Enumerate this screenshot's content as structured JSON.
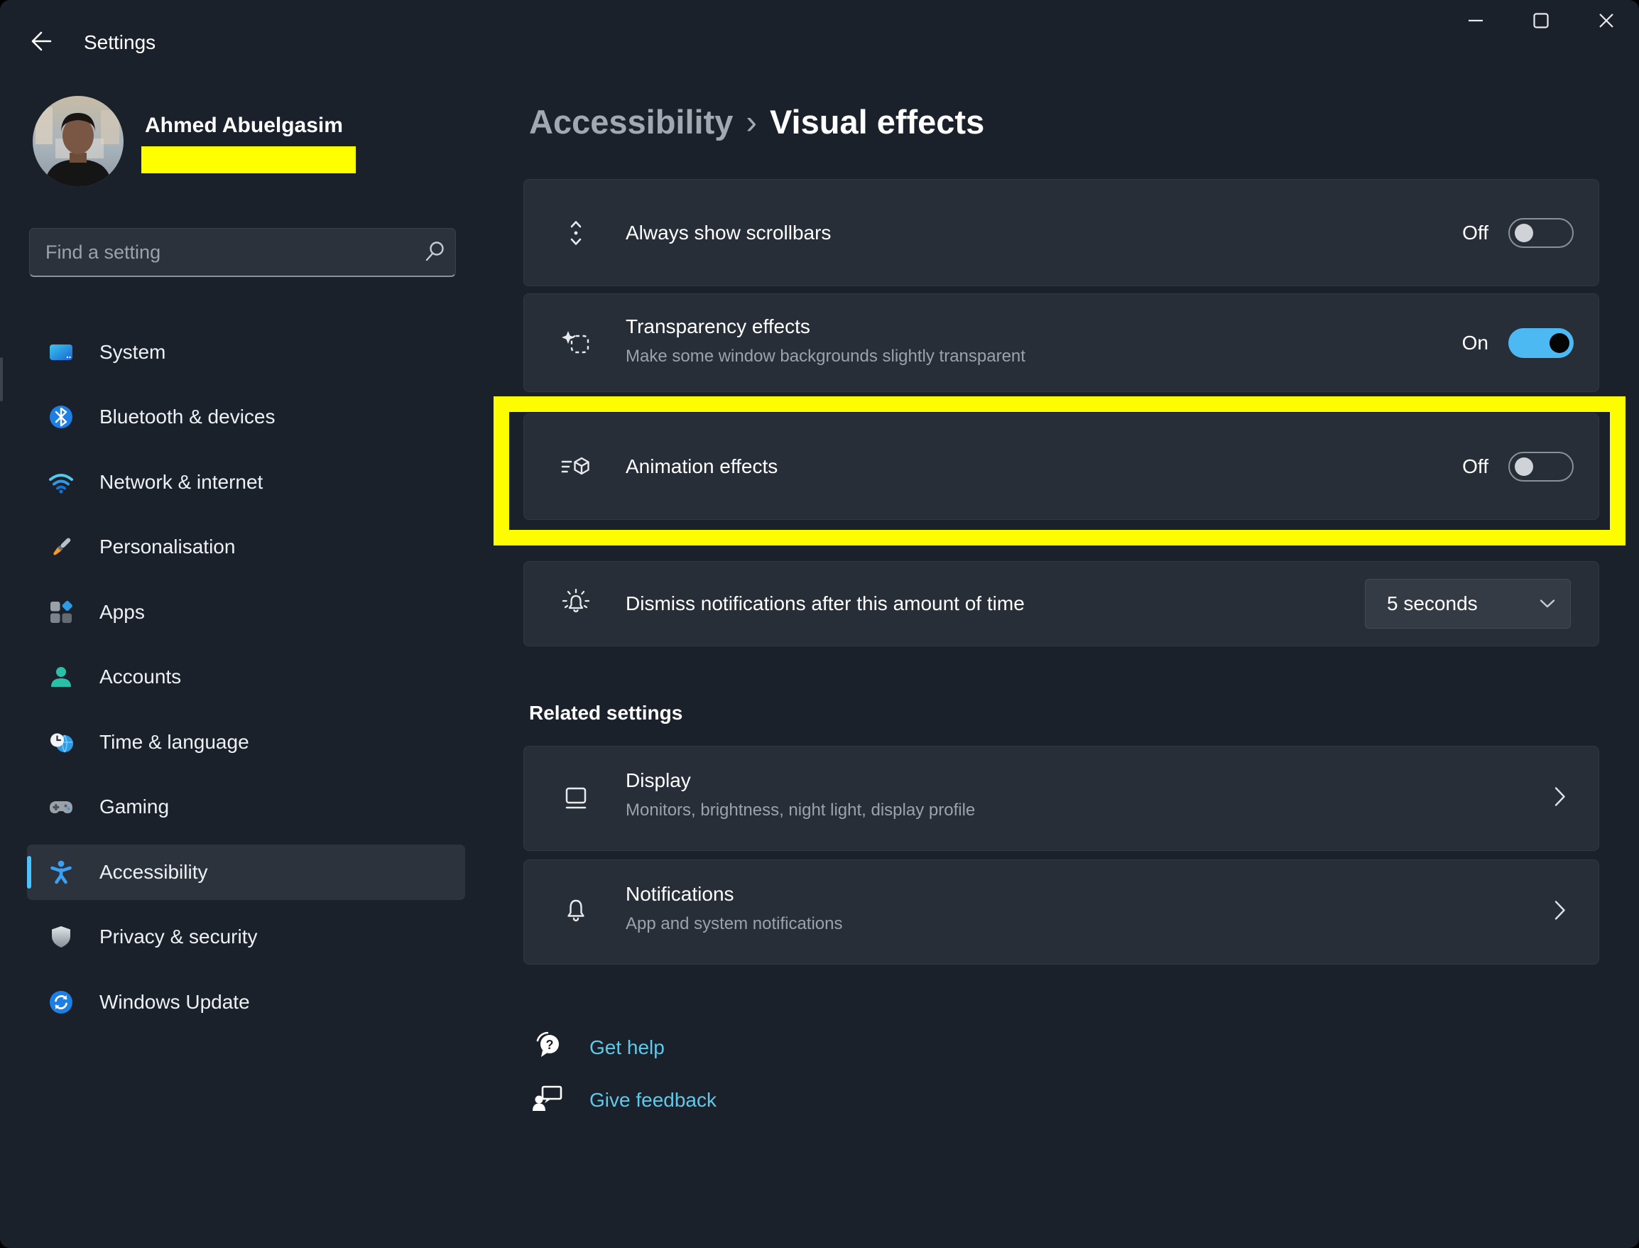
{
  "titlebar": {
    "app_title": "Settings"
  },
  "sidebar": {
    "user": {
      "name": "Ahmed Abuelgasim"
    },
    "search": {
      "placeholder": "Find a setting"
    },
    "items": [
      {
        "label": "System"
      },
      {
        "label": "Bluetooth & devices"
      },
      {
        "label": "Network & internet"
      },
      {
        "label": "Personalisation"
      },
      {
        "label": "Apps"
      },
      {
        "label": "Accounts"
      },
      {
        "label": "Time & language"
      },
      {
        "label": "Gaming"
      },
      {
        "label": "Accessibility",
        "selected": true
      },
      {
        "label": "Privacy & security"
      },
      {
        "label": "Windows Update"
      }
    ]
  },
  "breadcrumb": {
    "parent": "Accessibility",
    "separator": "›",
    "current": "Visual effects"
  },
  "settings": {
    "scrollbars": {
      "title": "Always show scrollbars",
      "state": "Off"
    },
    "transparency": {
      "title": "Transparency effects",
      "subtitle": "Make some window backgrounds slightly transparent",
      "state": "On"
    },
    "animation": {
      "title": "Animation effects",
      "state": "Off",
      "highlighted": true
    },
    "dismiss": {
      "title": "Dismiss notifications after this amount of time",
      "value": "5 seconds"
    }
  },
  "related": {
    "heading": "Related settings",
    "display": {
      "title": "Display",
      "subtitle": "Monitors, brightness, night light, display profile"
    },
    "notifications": {
      "title": "Notifications",
      "subtitle": "App and system notifications"
    }
  },
  "links": {
    "get_help": "Get help",
    "give_feedback": "Give feedback"
  },
  "colors": {
    "accent": "#4cc2ff",
    "toggle_on": "#4cb9f2",
    "annotation_highlight": "#ffff00",
    "link": "#5fc9eb",
    "background": "#1b212a",
    "card": "#272e37"
  }
}
